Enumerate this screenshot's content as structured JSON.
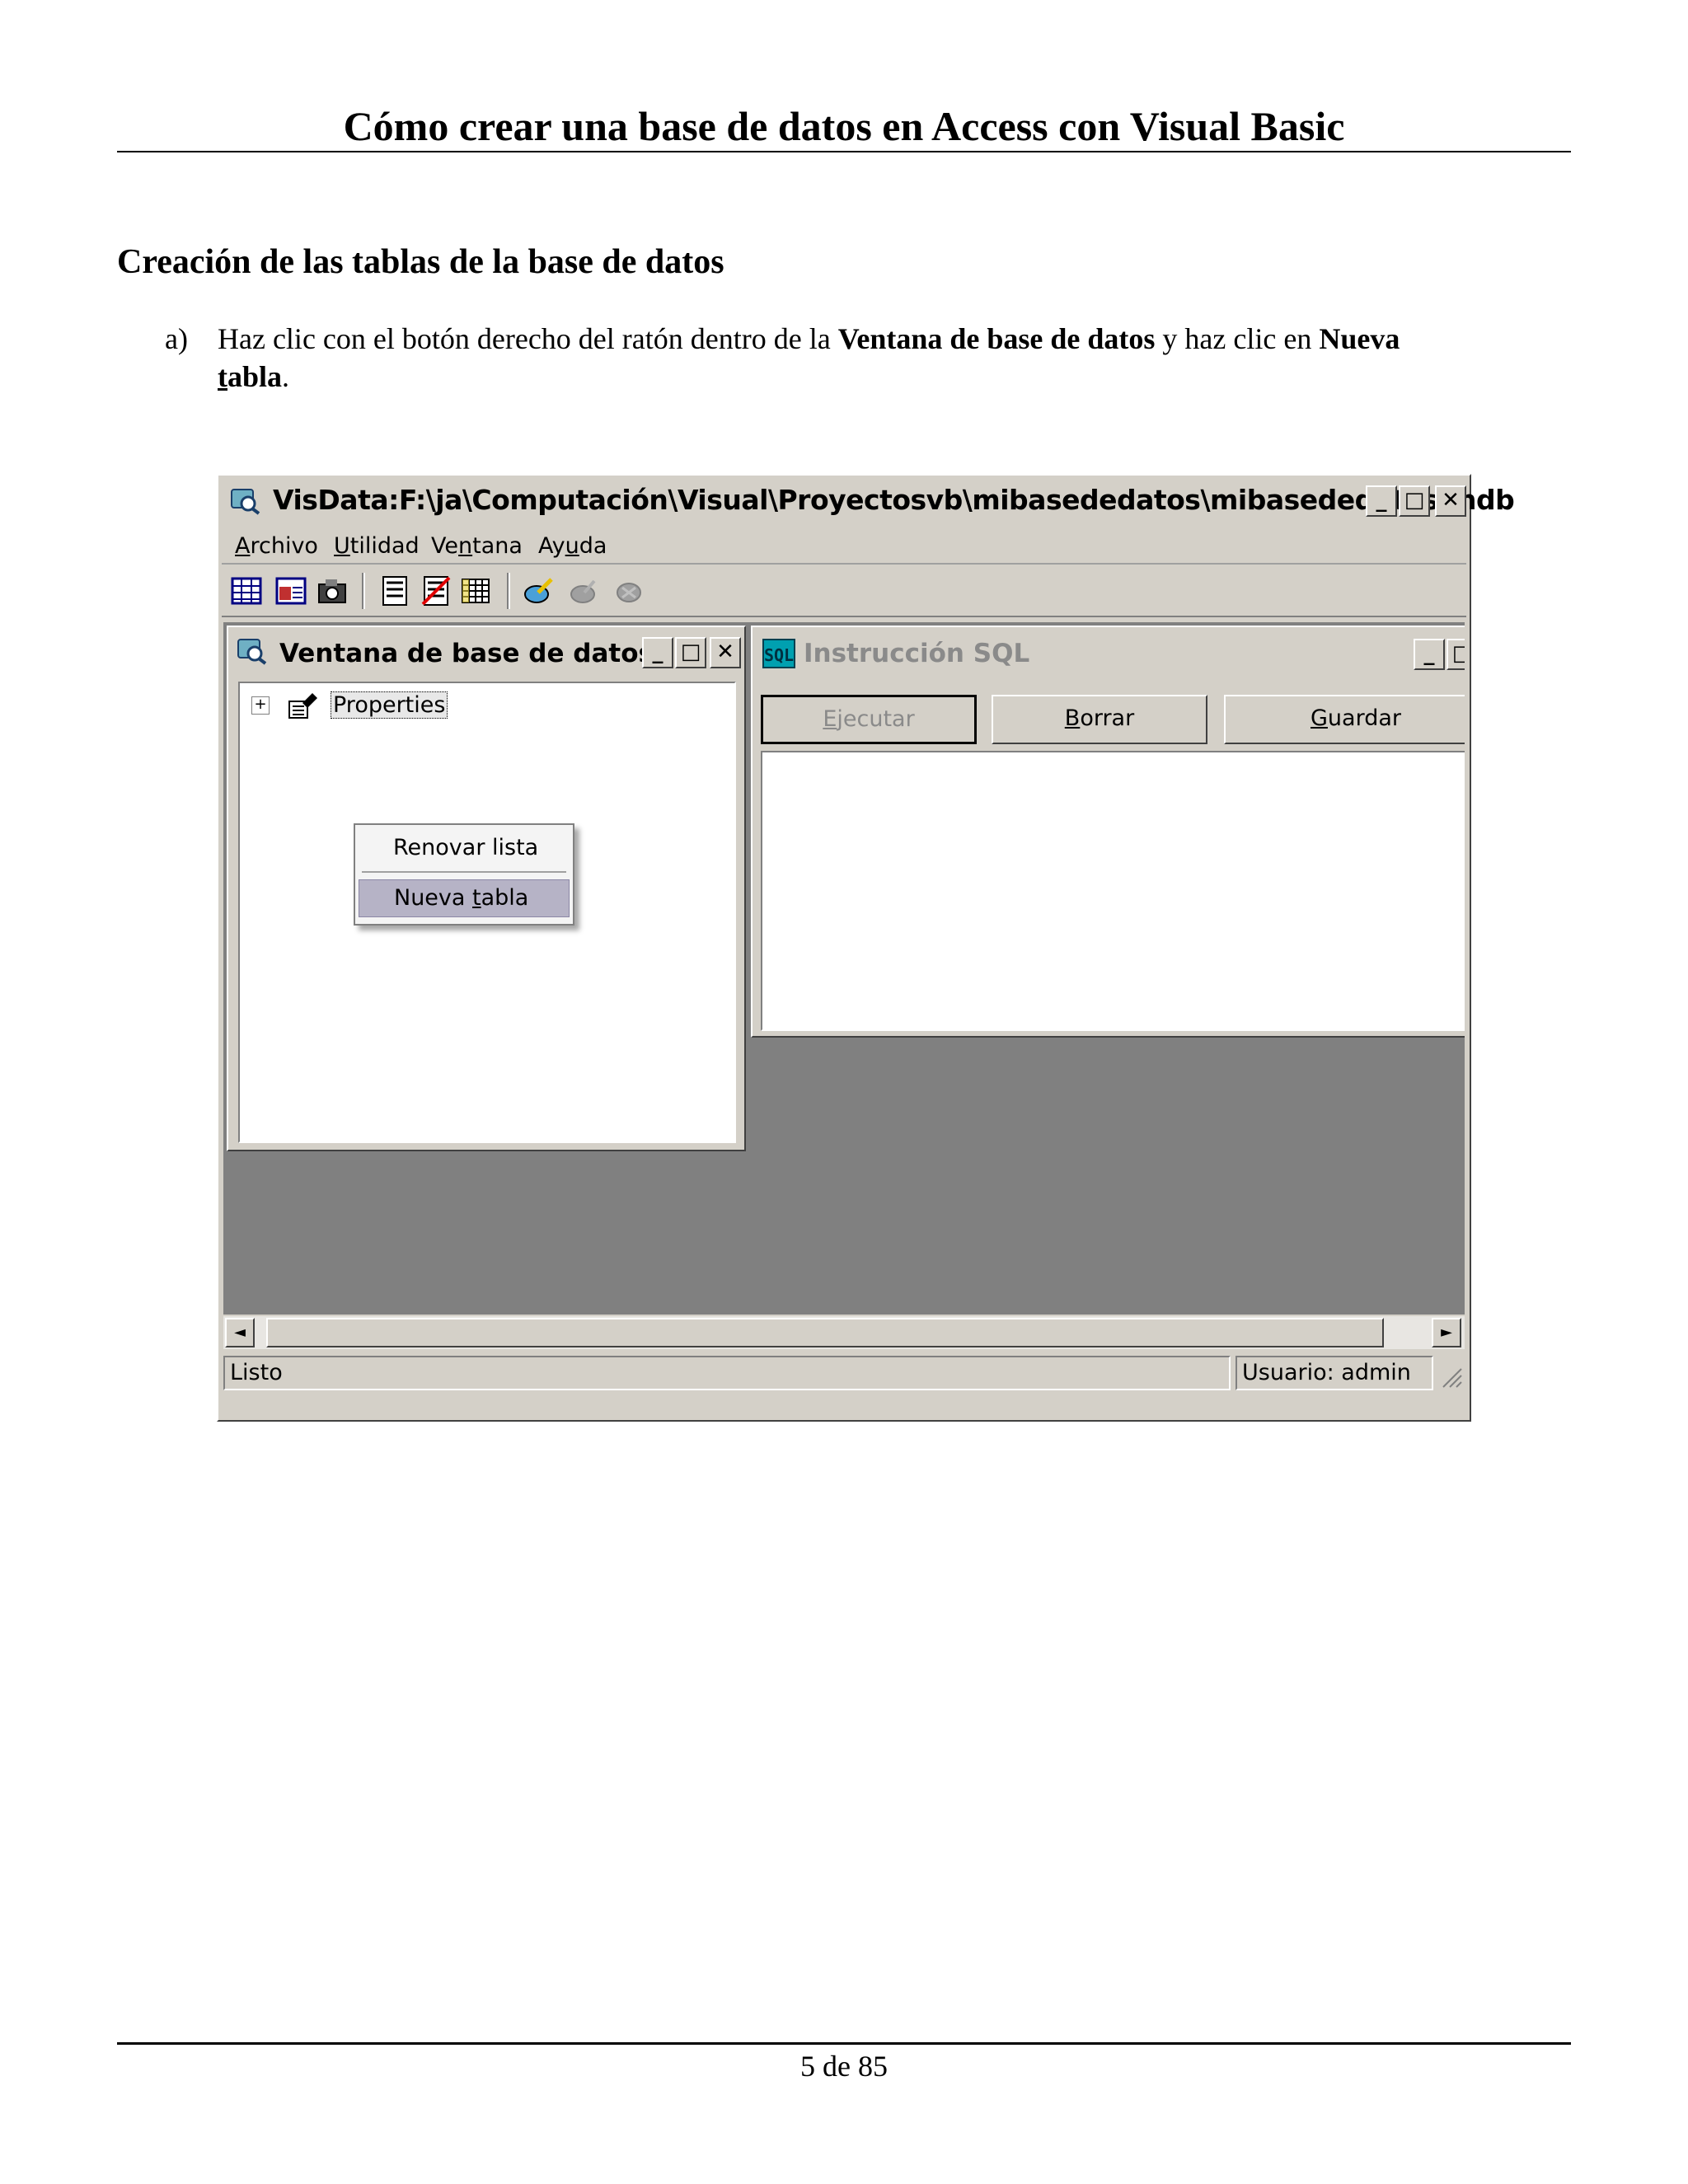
{
  "document": {
    "header": "Cómo crear una base de datos en Access con Visual Basic",
    "section_title": "Creación de las tablas de la base de datos",
    "step": {
      "marker": "a)",
      "text_1": "Haz clic con el botón derecho del ratón dentro de la ",
      "bold_1": "Ventana de base de datos",
      "text_2": " y haz clic en ",
      "bold_2a": "Nueva",
      "bold_2b_u": "t",
      "bold_2b": "abla",
      "text_3": "."
    },
    "footer": "5 de 85"
  },
  "app": {
    "title": "VisData:F:\\ja\\Computación\\Visual\\Proyectosvb\\mibasededatos\\mibasededatos.mdb",
    "window_buttons": {
      "minimize": "_",
      "maximize": "□",
      "close": "✕"
    },
    "menu": [
      {
        "u": "A",
        "rest": "rchivo"
      },
      {
        "u": "U",
        "rest": "tilidad"
      },
      {
        "pre": "Ve",
        "u": "n",
        "rest": "tana"
      },
      {
        "pre": "Ay",
        "u": "u",
        "rest": "da"
      }
    ],
    "db_window": {
      "title": "Ventana de base de datos",
      "tree_expand": "+",
      "tree_item": "Properties",
      "context_menu": {
        "item_1": "Renovar lista",
        "item_2_pre": "Nueva ",
        "item_2_u": "t",
        "item_2_rest": "abla"
      }
    },
    "sql_window": {
      "title": "Instrucción SQL",
      "icon_text": "SQL",
      "buttons": [
        {
          "u": "E",
          "rest": "jecutar"
        },
        {
          "u": "B",
          "rest": "orrar"
        },
        {
          "u": "G",
          "rest": "uardar"
        }
      ]
    },
    "scroll": {
      "left": "◄",
      "right": "►"
    },
    "status": {
      "left": "Listo",
      "user": "Usuario: admin"
    },
    "colors": {
      "face": "#d4d0c8",
      "mdi": "#808080",
      "highlight": "#b6b3c6"
    }
  }
}
